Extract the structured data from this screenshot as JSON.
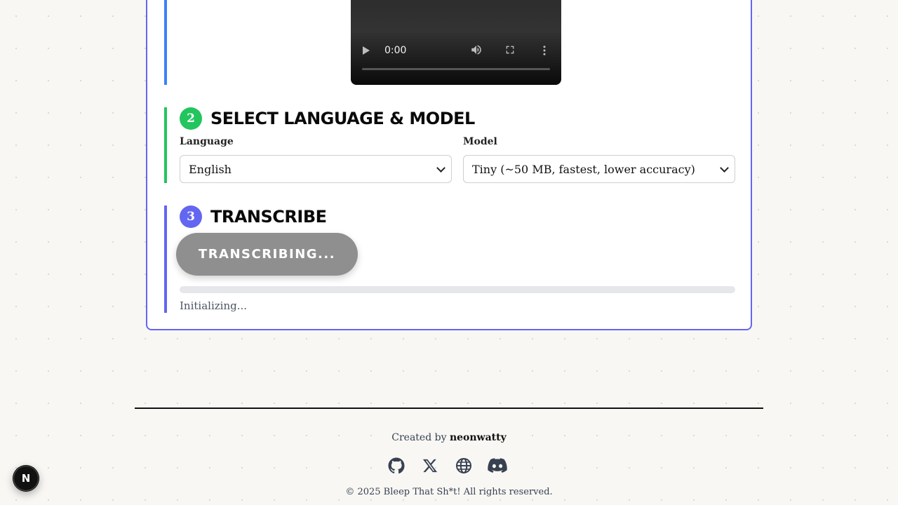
{
  "video": {
    "time": "0:00"
  },
  "steps": {
    "language_model": {
      "number": "2",
      "title": "SELECT LANGUAGE & MODEL",
      "language_label": "Language",
      "language_value": "English",
      "model_label": "Model",
      "model_value": "Tiny (~50 MB, fastest, lower accuracy)"
    },
    "transcribe": {
      "number": "3",
      "title": "TRANSCRIBE",
      "button_label": "TRANSCRIBING...",
      "progress": 0,
      "status": "Initializing..."
    }
  },
  "footer": {
    "created_by": "Created by",
    "author": "neonwatty",
    "copyright": "© 2025 Bleep That Sh*t! All rights reserved.",
    "icons": [
      "github-icon",
      "x-icon",
      "globe-icon",
      "discord-icon"
    ]
  },
  "next_badge": "N",
  "colors": {
    "accent": "#6366f1",
    "step_green": "#22c55e",
    "video_bar": "#3b82f6",
    "button_disabled": "#8f8f8f"
  }
}
